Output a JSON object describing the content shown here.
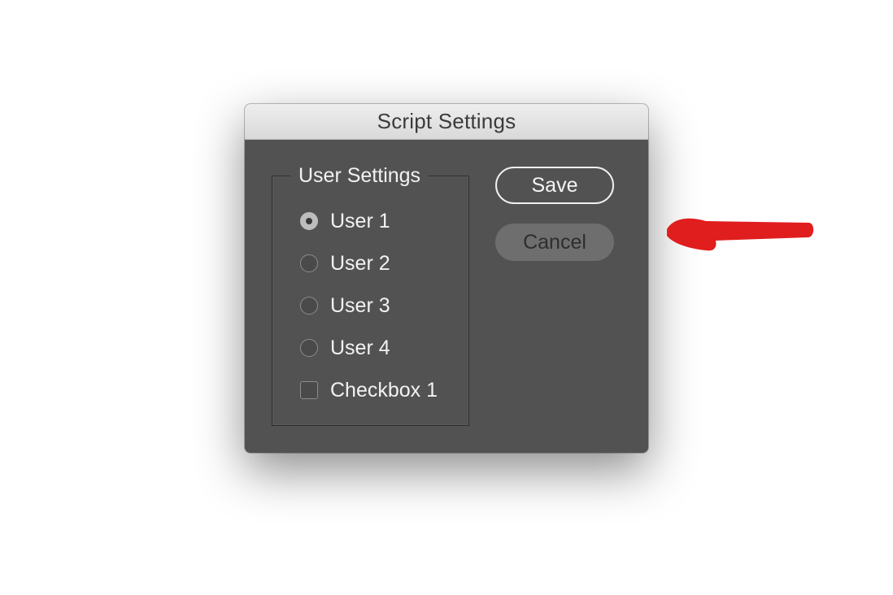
{
  "dialog": {
    "title": "Script Settings"
  },
  "user_settings": {
    "legend": "User Settings",
    "options": [
      {
        "label": "User 1",
        "type": "radio",
        "checked": true
      },
      {
        "label": "User 2",
        "type": "radio",
        "checked": false
      },
      {
        "label": "User 3",
        "type": "radio",
        "checked": false
      },
      {
        "label": "User 4",
        "type": "radio",
        "checked": false
      },
      {
        "label": "Checkbox 1",
        "type": "checkbox",
        "checked": false
      }
    ]
  },
  "buttons": {
    "save_label": "Save",
    "cancel_label": "Cancel"
  },
  "colors": {
    "dialog_bg": "#525252",
    "titlebar_bg": "#e3e3e3",
    "annotation_red": "#e01e1e"
  }
}
